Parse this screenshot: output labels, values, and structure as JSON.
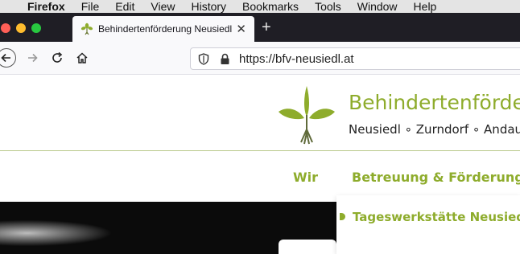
{
  "menubar": {
    "app": "Firefox",
    "items": [
      "File",
      "Edit",
      "View",
      "History",
      "Bookmarks",
      "Tools",
      "Window",
      "Help"
    ]
  },
  "tab": {
    "title": "Behindertenförderung Neusiedl"
  },
  "address_bar": {
    "url": "https://bfv-neusiedl.at"
  },
  "site": {
    "title": "Behindertenförderu",
    "subtitle": "Neusiedl ∘ Zurndorf ∘ Andau ∘",
    "nav": [
      "Wir",
      "Betreuung & Förderung"
    ],
    "dropdown_item": "Tageswerkstätte Neusiedl",
    "accent": "#8eac2c"
  }
}
